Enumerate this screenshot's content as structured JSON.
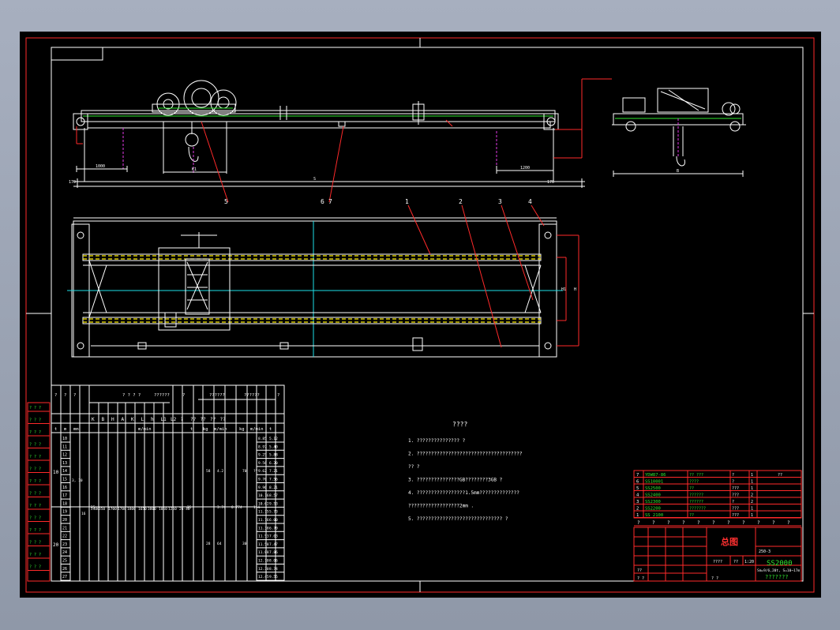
{
  "drawing": {
    "background": "#000000",
    "border_color": "#ff2a2a",
    "line_color": "#ffffff",
    "accent_color": "#31e831",
    "rail_color": "#ffee00",
    "centerline_color": "#1ee0e8"
  },
  "callouts": [
    "5",
    "6",
    "7",
    "1",
    "2",
    "3",
    "4"
  ],
  "dimensions": {
    "left_end": "1000",
    "right_end": "1200",
    "span": "S",
    "left_margin": "170",
    "right_margin": "170",
    "end_view_width": "B",
    "trolley_gauge": "K1",
    "track_gauge": "H",
    "h1": "H1"
  },
  "spec_table": {
    "header_cells": [
      "?",
      "?",
      "?",
      "? ? ? ?",
      "??????",
      "?",
      "??????",
      "??????",
      "?"
    ],
    "subheaders": [
      "K",
      "B",
      "H",
      "A",
      "K",
      "L",
      "h",
      "L1",
      "L2",
      "?",
      "??",
      "??",
      "??",
      "??"
    ],
    "units": [
      "t",
      "m",
      "mm",
      "m/min",
      "t",
      "kg",
      "m/min",
      "kg",
      "m/min",
      "t"
    ],
    "groups": [
      "10",
      "20"
    ],
    "spans": [
      "10",
      "11",
      "12",
      "13",
      "14",
      "15",
      "16",
      "17",
      "18",
      "19",
      "20",
      "21",
      "22",
      "23",
      "24",
      "25",
      "26",
      "27"
    ],
    "last_col_a": [
      "8.85",
      "8.97",
      "9.25",
      "9.56",
      "9.62",
      "9.76",
      "9.96",
      "10.16",
      "10.62",
      "11.15",
      "11.16",
      "11.38",
      "11.53",
      "11.58",
      "11.88",
      "12.10",
      "12.30",
      "12.45"
    ],
    "last_col_b": [
      "5.12",
      "5.40",
      "5.88",
      "6.20",
      "7.21",
      "7.56",
      "8.21",
      "8.57",
      "9.53",
      "5.73",
      "6.00",
      "6.70",
      "7.03",
      "7.47",
      "7.86",
      "8.06",
      "8.74",
      "9.55"
    ],
    "middle_values": [
      "3, 10",
      "4.2",
      "??",
      "58",
      "25",
      "70",
      "25",
      "3.74",
      "0.774",
      "1.4",
      "16",
      "2400",
      "350",
      "1700",
      "1700",
      "1800",
      "1650",
      "3800",
      "1050",
      "1250",
      "26-40",
      "28",
      "64",
      "30"
    ],
    "side_labels": [
      "? ? ?",
      "? ? ?",
      "? ? ?",
      "? ? ?",
      "? ? ?",
      "? ? ?",
      "? ? ?",
      "? ? ?",
      "? ? ?",
      "? ? ?",
      "? ? ?",
      "? ? ?",
      "? ? ?",
      "? ? ?"
    ]
  },
  "notes": {
    "title": "????",
    "lines": [
      "1. ??????????????? ?",
      "2. ?????????????????????????????????????",
      "   ?? ?",
      "3. ???????????????GB????????3GB ?",
      "4. ?????????????????1.5mm??????????????",
      "   ??????????????????2mm .",
      "5. ?????????????????????????????? ?"
    ]
  },
  "parts_list": {
    "rows": [
      {
        "no": "7",
        "code": "YDW87-86",
        "name": "?? ???",
        "qty": "?",
        "mat": "1",
        "note": "??"
      },
      {
        "no": "6",
        "code": "SS10001",
        "name": "????",
        "qty": "?",
        "mat": "1",
        "note": ""
      },
      {
        "no": "5",
        "code": "SS2500",
        "name": "??",
        "qty": "???",
        "mat": "1",
        "note": ""
      },
      {
        "no": "4",
        "code": "SS2400",
        "name": "??????",
        "qty": "???",
        "mat": "2",
        "note": ""
      },
      {
        "no": "3",
        "code": "SS2300",
        "name": "??????",
        "qty": "?",
        "mat": "2",
        "note": ""
      },
      {
        "no": "2",
        "code": "SS2200",
        "name": "???????",
        "qty": "???",
        "mat": "1",
        "note": ""
      },
      {
        "no": "1",
        "code": "SS 2100",
        "name": "??",
        "qty": "???",
        "mat": "1",
        "note": ""
      }
    ],
    "header": [
      "?",
      "?",
      "?",
      "?",
      "?",
      "?",
      "?",
      "?",
      "?",
      "?",
      "?"
    ]
  },
  "title_block": {
    "title": "总图",
    "drawing_code": "SS2000",
    "ref": "250-3",
    "spec": "Sm=9/6,20t, S=10~17m",
    "company": "???????",
    "scale": "1:20",
    "misc": [
      "????",
      "??",
      "??",
      "? ?",
      "? ?"
    ]
  }
}
